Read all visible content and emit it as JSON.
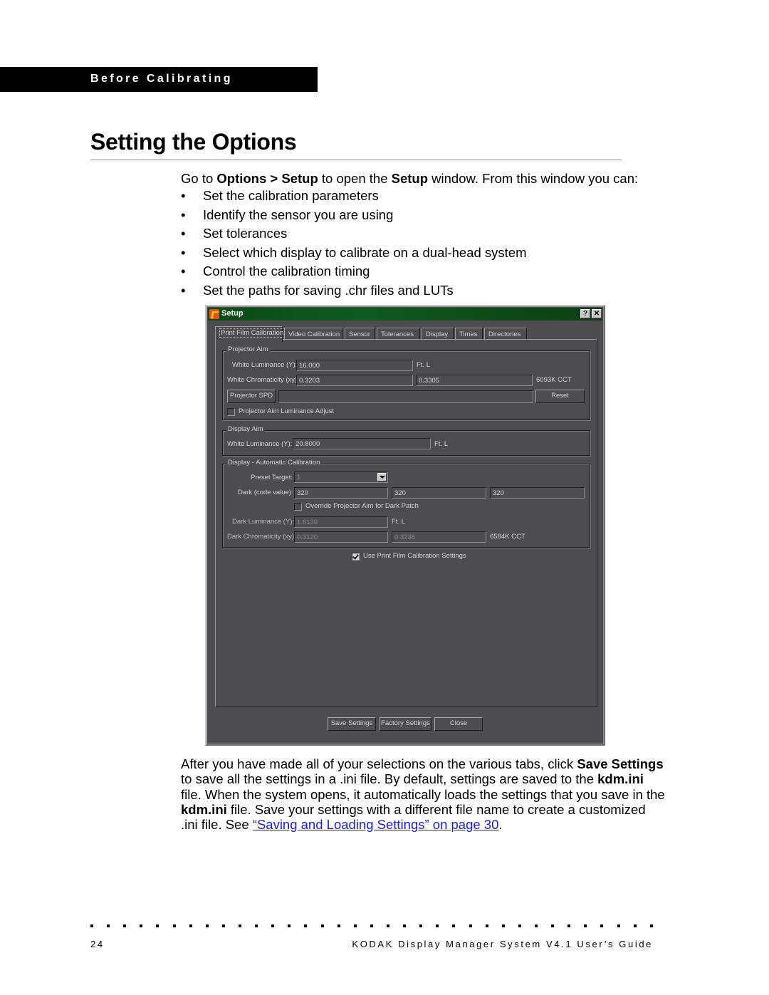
{
  "header": {
    "section": "Before Calibrating"
  },
  "title": "Setting the Options",
  "intro": {
    "prefix": "Go to ",
    "options": "Options",
    "sep": " > ",
    "setup": "Setup",
    "mid": " to open the ",
    "setup2": "Setup",
    "suffix": " window. From this window you can:"
  },
  "bullet_glyph": "•",
  "bullets": [
    "Set the calibration parameters",
    "Identify the sensor you are using",
    "Set tolerances",
    "Select which display to calibrate on a dual-head system",
    "Control the calibration timing",
    "Set the paths for saving .chr files and LUTs"
  ],
  "window": {
    "title": "Setup",
    "help_btn": "?",
    "close_btn": "✕",
    "tabs": [
      "Print Film Calibration",
      "Video Calibration",
      "Sensor",
      "Tolerances",
      "Display",
      "Times",
      "Directories"
    ],
    "active_tab": "Print Film Calibration",
    "projector_aim": {
      "legend": "Projector Aim",
      "white_lum_label": "White Luminance (Y):",
      "white_lum_value": "16.000",
      "white_lum_unit": "Ft. L",
      "white_chroma_label": "White Chromaticity (xy):",
      "white_chroma_x": "0.3203",
      "white_chroma_y": "0.3305",
      "cct": "6093K CCT",
      "spd_button": "Projector SPD",
      "spd_value": "",
      "reset_button": "Reset",
      "lum_adjust_label": "Projector Aim Luminance Adjust",
      "lum_adjust_checked": false
    },
    "display_aim": {
      "legend": "Display Aim",
      "white_lum_label": "White Luminance (Y):",
      "white_lum_value": "20.8000",
      "white_lum_unit": "Ft. L"
    },
    "auto_cal": {
      "legend": "Display - Automatic Calibration",
      "preset_label": "Preset Target:",
      "preset_value": "1",
      "dark_label": "Dark (code value):",
      "dark_values": [
        "320",
        "320",
        "320"
      ],
      "override_label": "Override Projector Aim for Dark Patch",
      "override_checked": false,
      "dark_lum_label": "Dark Luminance (Y):",
      "dark_lum_value": "1.6139",
      "dark_lum_unit": "Ft. L",
      "dark_chroma_label": "Dark Chromaticity (xy):",
      "dark_chroma_x": "0.3120",
      "dark_chroma_y": "0.3236",
      "dark_cct": "6584K CCT"
    },
    "use_print_film_label": "Use Print Film Calibration Settings",
    "use_print_film_checked": true,
    "buttons": {
      "save": "Save Settings",
      "factory": "Factory Settings",
      "close": "Close"
    }
  },
  "after": {
    "t1": "After you have made all of your selections on the various tabs, click ",
    "b1": "Save Settings",
    "t2": " to save all the settings in a .ini file. By default, settings are saved to the ",
    "b2": "kdm.ini",
    "t3": " file. When the system opens, it automatically loads the settings that you save in the ",
    "b3": "kdm.ini",
    "t4": " file. Save your settings with a different file name to create a customized .ini file. See ",
    "link": "“Saving and Loading Settings” on page 30",
    "t5": "."
  },
  "footer": {
    "page_number": "24",
    "guide_title": "KODAK Display Manager System V4.1 User’s Guide"
  }
}
